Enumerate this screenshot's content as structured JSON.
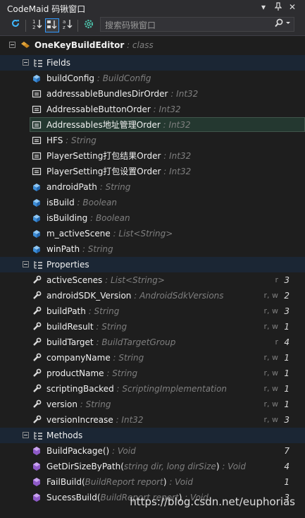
{
  "window": {
    "title": "CodeMaid 码锹窗口",
    "buttons": {
      "dropdown": "▾",
      "pin": "📌",
      "close": "✕"
    }
  },
  "toolbar": {
    "refresh_icon": "refresh-icon",
    "sort_alpha_icon": "sort-alpha-icon",
    "sort_type_icon": "sort-type-icon",
    "sort_file_icon": "sort-file-icon",
    "settings_icon": "gear-icon"
  },
  "search": {
    "placeholder": "搜索码锹窗口",
    "value": ""
  },
  "colors": {
    "field_icon": "#4a9de0",
    "property_icon": "#dcdcdc",
    "method_icon": "#b180d7",
    "class_icon": "#e0a33a",
    "group_bg": "#1b2634",
    "highlight": "#243830"
  },
  "tree": {
    "root": {
      "name": "OneKeyBuildEditor",
      "type": ": class"
    },
    "groups": [
      {
        "label": "Fields",
        "items": [
          {
            "name": "buildConfig",
            "type": ": BuildConfig",
            "icon": "field-icon"
          },
          {
            "name": "addressableBundlesDirOrder",
            "type": ": Int32",
            "icon": "const-icon"
          },
          {
            "name": "AddressableButtonOrder",
            "type": ": Int32",
            "icon": "const-icon"
          },
          {
            "name": "Addressables地址管理Order",
            "type": ": Int32",
            "icon": "const-icon",
            "selected": true
          },
          {
            "name": "HFS",
            "type": ": String",
            "icon": "const-icon"
          },
          {
            "name": "PlayerSetting打包结果Order",
            "type": ": Int32",
            "icon": "const-icon"
          },
          {
            "name": "PlayerSetting打包设置Order",
            "type": ": Int32",
            "icon": "const-icon"
          },
          {
            "name": "androidPath",
            "type": ": String",
            "icon": "field-icon"
          },
          {
            "name": "isBuild",
            "type": ": Boolean",
            "icon": "field-icon"
          },
          {
            "name": "isBuilding",
            "type": ": Boolean",
            "icon": "field-icon"
          },
          {
            "name": "m_activeScene",
            "type": ": List<String>",
            "icon": "field-icon"
          },
          {
            "name": "winPath",
            "type": ": String",
            "icon": "field-icon"
          }
        ]
      },
      {
        "label": "Properties",
        "items": [
          {
            "name": "activeScenes",
            "type": ": List<String>",
            "rw": "r",
            "count": "3"
          },
          {
            "name": "androidSDK_Version",
            "type": ": AndroidSdkVersions",
            "rw": "r, w",
            "count": "2"
          },
          {
            "name": "buildPath",
            "type": ": String",
            "rw": "r, w",
            "count": "3"
          },
          {
            "name": "buildResult",
            "type": ": String",
            "rw": "r, w",
            "count": "1"
          },
          {
            "name": "buildTarget",
            "type": ": BuildTargetGroup",
            "rw": "r",
            "count": "4"
          },
          {
            "name": "companyName",
            "type": ": String",
            "rw": "r, w",
            "count": "1"
          },
          {
            "name": "productName",
            "type": ": String",
            "rw": "r, w",
            "count": "1"
          },
          {
            "name": "scriptingBacked",
            "type": ": ScriptingImplementation",
            "rw": "r, w",
            "count": "1"
          },
          {
            "name": "version",
            "type": ": String",
            "rw": "r, w",
            "count": "1"
          },
          {
            "name": "versionIncrease",
            "type": ": Int32",
            "rw": "r, w",
            "count": "3"
          }
        ]
      },
      {
        "label": "Methods",
        "items": [
          {
            "name": "BuildPackage()",
            "type": ": Void",
            "count": "7"
          },
          {
            "name": "GetDirSizeByPath(",
            "params": "string dir, long dirSize",
            "close": ")",
            "type": ": Void",
            "count": "4"
          },
          {
            "name": "FailBuild(",
            "params": "BuildReport report",
            "close": ")",
            "type": ": Void",
            "count": "1"
          },
          {
            "name": "SucessBuild(",
            "params": "BuildReport report",
            "close": ")",
            "type": ": Void",
            "count": "3"
          }
        ]
      }
    ]
  },
  "watermark": "https://blog.csdn.net/euphorias"
}
